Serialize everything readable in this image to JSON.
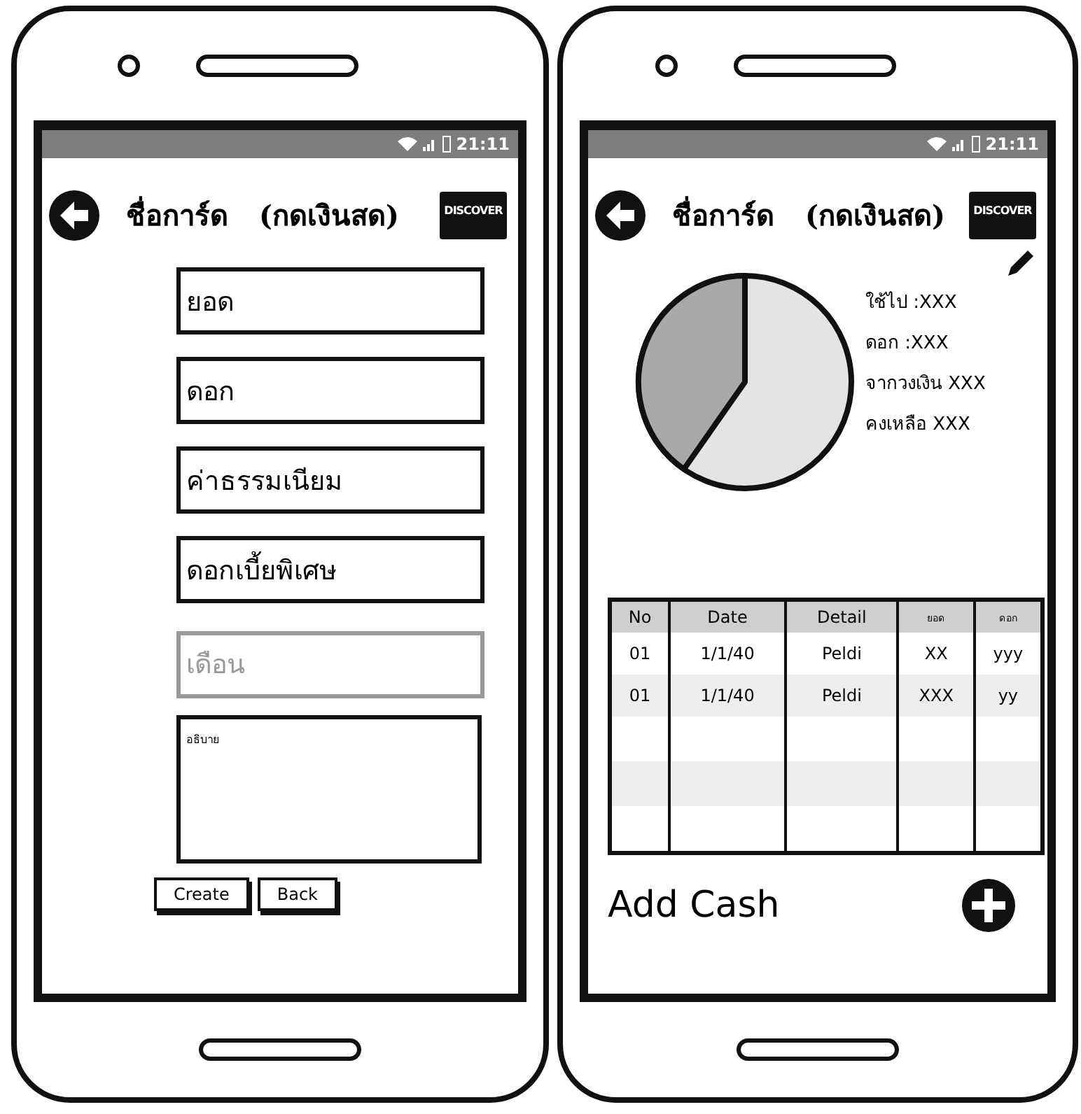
{
  "phones": [
    {
      "kind": "form",
      "status_bar": {
        "time": "21:11"
      },
      "header": {
        "title": "ชื่อการ์ด",
        "subtitle": "(กดเงินสด)",
        "card_logo": "DISCOVER"
      },
      "fields": [
        {
          "value": "ยอด"
        },
        {
          "value": "ดอก"
        },
        {
          "value": "ค่าธรรมเนียม"
        },
        {
          "value": "ดอกเบี้ยพิเศษ"
        },
        {
          "placeholder": "เดือน"
        }
      ],
      "notes": {
        "value": "อธิบาย"
      },
      "buttons": [
        "Create",
        "Back"
      ]
    },
    {
      "kind": "summary",
      "status_bar": {
        "time": "21:11"
      },
      "header": {
        "title": "ชื่อการ์ด",
        "subtitle": "(กดเงินสด)",
        "card_logo": "DISCOVER"
      },
      "legend": [
        "ใช้ไป :XXX",
        "ดอก :XXX",
        "จากวงเงิน XXX",
        "คงเหลือ  XXX"
      ],
      "table": {
        "columns": [
          "No",
          "Date",
          "Detail",
          "ยอด",
          "ดอก"
        ],
        "rows": [
          [
            "01",
            "1/1/40",
            "Peldi",
            "XX",
            "yyy"
          ],
          [
            "01",
            "1/1/40",
            "Peldi",
            "XXX",
            "yy"
          ]
        ]
      },
      "add_label": "Add Cash"
    }
  ]
}
